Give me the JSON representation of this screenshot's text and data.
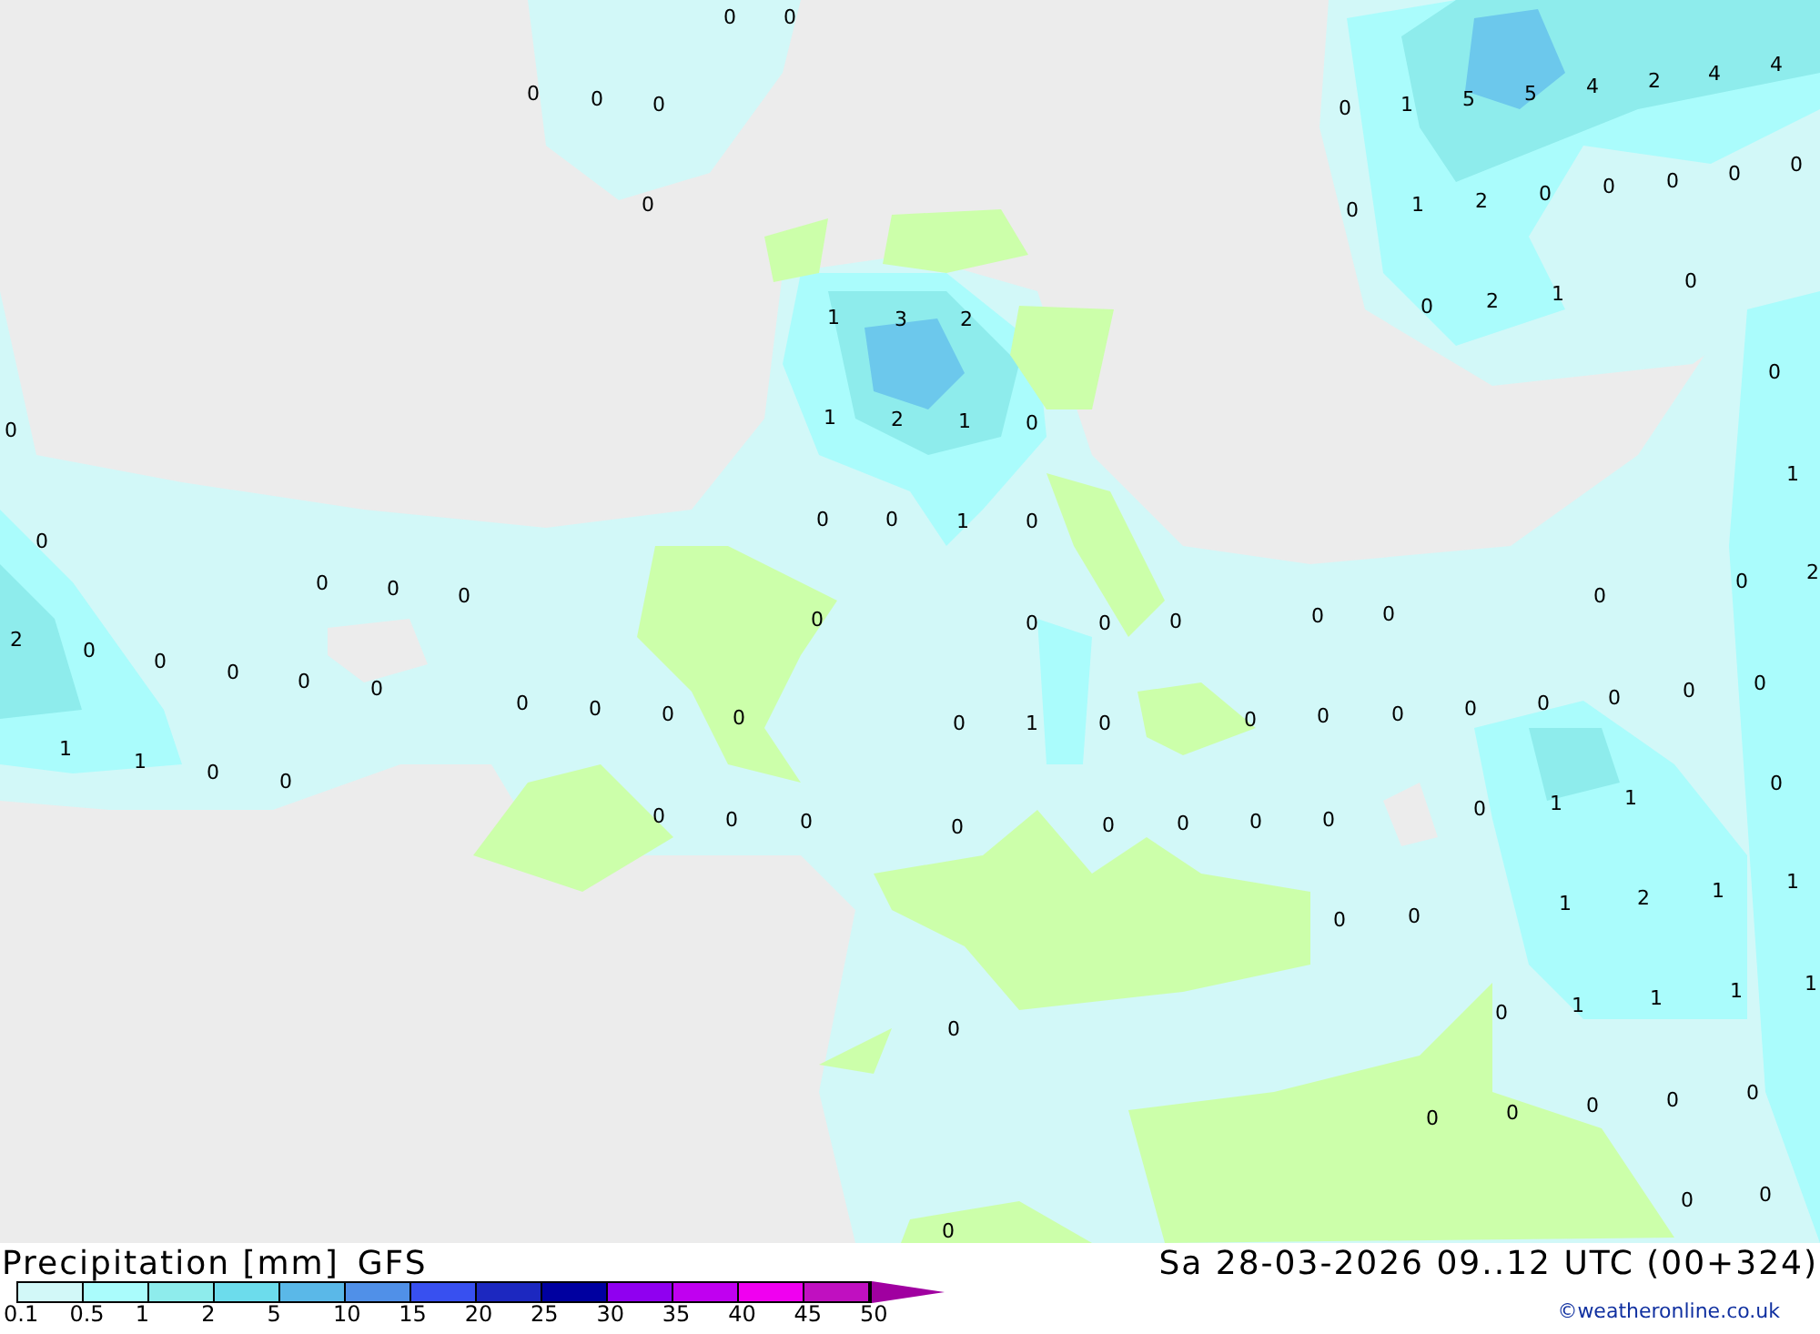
{
  "map": {
    "labels": [
      "0",
      "0",
      "0",
      "0",
      "0",
      "0",
      "0",
      "1",
      "5",
      "5",
      "4",
      "2",
      "4",
      "4",
      "0",
      "1",
      "2",
      "0",
      "0",
      "0",
      "0",
      "0",
      "0",
      "2",
      "1",
      "0",
      "0",
      "1",
      "0",
      "2",
      "0",
      "1",
      "3",
      "2",
      "1",
      "2",
      "1",
      "0",
      "0",
      "0",
      "1",
      "0",
      "0",
      "0",
      "0",
      "0",
      "0",
      "2",
      "0",
      "0",
      "0",
      "0",
      "0",
      "1",
      "1",
      "0",
      "0",
      "0",
      "0",
      "0",
      "0",
      "0",
      "0",
      "0",
      "0",
      "0",
      "0",
      "0",
      "0",
      "0",
      "0",
      "1",
      "0",
      "0",
      "0",
      "0",
      "0",
      "0",
      "0",
      "0",
      "0",
      "0",
      "0",
      "0",
      "0",
      "0",
      "0",
      "1",
      "1",
      "0",
      "0",
      "0",
      "1",
      "2",
      "1",
      "1",
      "0",
      "0",
      "1",
      "1",
      "1",
      "1",
      "0",
      "0",
      "0",
      "0",
      "0",
      "0",
      "0",
      "0"
    ]
  },
  "legend": {
    "title": "Precipitation [mm]",
    "model": "GFS",
    "swatches": [
      {
        "kind": "bar",
        "color": "#d2f8f8"
      },
      {
        "kind": "bar",
        "color": "#aafcfc"
      },
      {
        "kind": "bar",
        "color": "#8eecec"
      },
      {
        "kind": "bar",
        "color": "#6cdcec"
      },
      {
        "kind": "bar",
        "color": "#5ab8e8"
      },
      {
        "kind": "bar",
        "color": "#5090e8"
      },
      {
        "kind": "bar",
        "color": "#3850f0"
      },
      {
        "kind": "bar",
        "color": "#1c28c0"
      },
      {
        "kind": "bar",
        "color": "#0000a0"
      },
      {
        "kind": "bar",
        "color": "#9000f0"
      },
      {
        "kind": "bar",
        "color": "#c000f0"
      },
      {
        "kind": "bar",
        "color": "#f000f0"
      },
      {
        "kind": "bar",
        "color": "#c010c0"
      },
      {
        "kind": "arrow",
        "color": "#a000a0"
      }
    ],
    "ticks": [
      "0.1",
      "0.5",
      "1",
      "2",
      "5",
      "10",
      "15",
      "20",
      "25",
      "30",
      "35",
      "40",
      "45",
      "50"
    ]
  },
  "valid_time": "Sa 28-03-2026 09..12 UTC (00+324)",
  "credit": "©weatheronline.co.uk"
}
